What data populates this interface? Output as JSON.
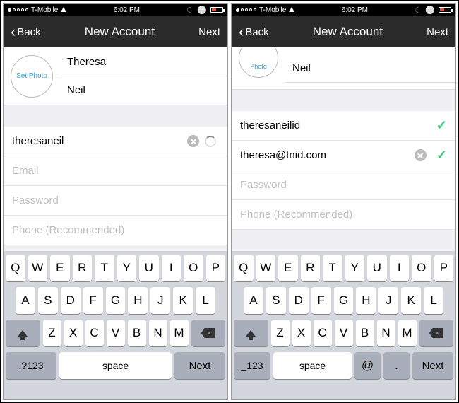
{
  "statusbar": {
    "carrier": "T-Mobile",
    "time": "6:02 PM"
  },
  "nav": {
    "back": "Back",
    "title": "New Account",
    "next": "Next"
  },
  "left": {
    "setphoto": "Set Photo",
    "firstname": "Theresa",
    "lastname": "Neil",
    "username": "theresaneil",
    "email_ph": "Email",
    "password_ph": "Password",
    "phone_ph": "Phone (Recommended)"
  },
  "right": {
    "setphoto_partial": "Photo",
    "lastname": "Neil",
    "username": "theresaneilid",
    "email": "theresa@tnid.com",
    "password_ph": "Password",
    "phone_ph": "Phone (Recommended)"
  },
  "keys": {
    "row1": [
      "Q",
      "W",
      "E",
      "R",
      "T",
      "Y",
      "U",
      "I",
      "O",
      "P"
    ],
    "row2": [
      "A",
      "S",
      "D",
      "F",
      "G",
      "H",
      "J",
      "K",
      "L"
    ],
    "row3": [
      "Z",
      "X",
      "C",
      "V",
      "B",
      "N",
      "M"
    ],
    "num1": ".?123",
    "num2": "_123",
    "space": "space",
    "next": "Next",
    "at": "@",
    "dot": "."
  }
}
